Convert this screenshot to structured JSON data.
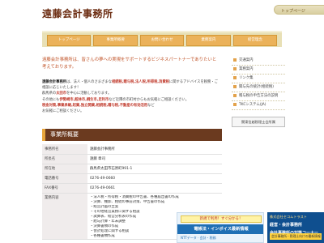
{
  "header": {
    "site_title": "遠藤会計事務所",
    "top_link": "トップページ"
  },
  "nav": {
    "items": [
      {
        "label": "トップページ"
      },
      {
        "label": "事業所概要"
      },
      {
        "label": "お問い合わせ"
      },
      {
        "label": "業務案内"
      },
      {
        "label": "経営理念"
      }
    ]
  },
  "lead": {
    "text": "遠藤会計事務所は、皆さんの夢への実現をサポートするビジネスパートナーでありたいと考えております。"
  },
  "intro": {
    "p1_name": "遠藤会計事務所",
    "p1_a": "は、法人・個人のさまざまな",
    "p1_keywords": "相続税,贈与税,法人税,所得税,消費税",
    "p1_b": "に関するアドバイスを税務・ご相談に応じいたします！",
    "p2_a": "群馬県の",
    "p2_city": "太田市",
    "p2_b": "を中心に活動しております。",
    "p3_a": "その他にも",
    "p3_cities": "伊勢崎市,館林市,桐生市,足利市",
    "p3_b": "など近隣の市町村からもお気軽にご相談ください。",
    "p4_keywords": "税金対策,事業承継,起業,独立開業,相続税,贈与税,不動産の有効活用",
    "p4_b": "など",
    "p5": "お気軽にご相談ください。"
  },
  "sidebar": {
    "items": [
      {
        "label": "交通案内"
      },
      {
        "label": "業務案内"
      },
      {
        "label": "リンク集"
      },
      {
        "label": "関与先の統計(相続税)"
      },
      {
        "label": "贈与税の申告方法の説明"
      },
      {
        "label": "TKCシステム(JA)"
      }
    ],
    "banner": "関東信越税理士会所属"
  },
  "section": {
    "title": "事業所概要"
  },
  "profile": {
    "rows": [
      {
        "label": "事務所名",
        "value": "遠藤会計事務所"
      },
      {
        "label": "所長名",
        "value": "遠藤 章司"
      },
      {
        "label": "所在地",
        "value": "群馬県太田市石原町991-1"
      },
      {
        "label": "電話番号",
        "value": "0276-49-0660"
      },
      {
        "label": "FAX番号",
        "value": "0276-49-0661"
      }
    ],
    "business_label": "業務内容",
    "business_items": [
      "・法人税・所得税・消費税の申告書、各種届出書の作成",
      "・決算、棚卸、相続の事前対策、申告書の作成",
      "・経営計画の立案",
      "・その他経営業務に関する相談",
      "・試算表、経営分析表の作成",
      "・給与計算・年末調整",
      "・決算書類の作成",
      "・会計処理に関する相談",
      "・各種書類作成"
    ]
  },
  "ads": {
    "left_top": "新規で利用！すぐ分かる！",
    "left_main": "電帳法・インボイス最新情報",
    "left_bottom": "NTTデータ · 会計・税務"
  },
  "ads2": {
    "brand": "株式会社セコムトラスト",
    "line1": "経営・会計事務所",
    "line2": "会計事務所の対策コーナー",
    "bar": "会計事務所・税理士向けの最新情報"
  }
}
